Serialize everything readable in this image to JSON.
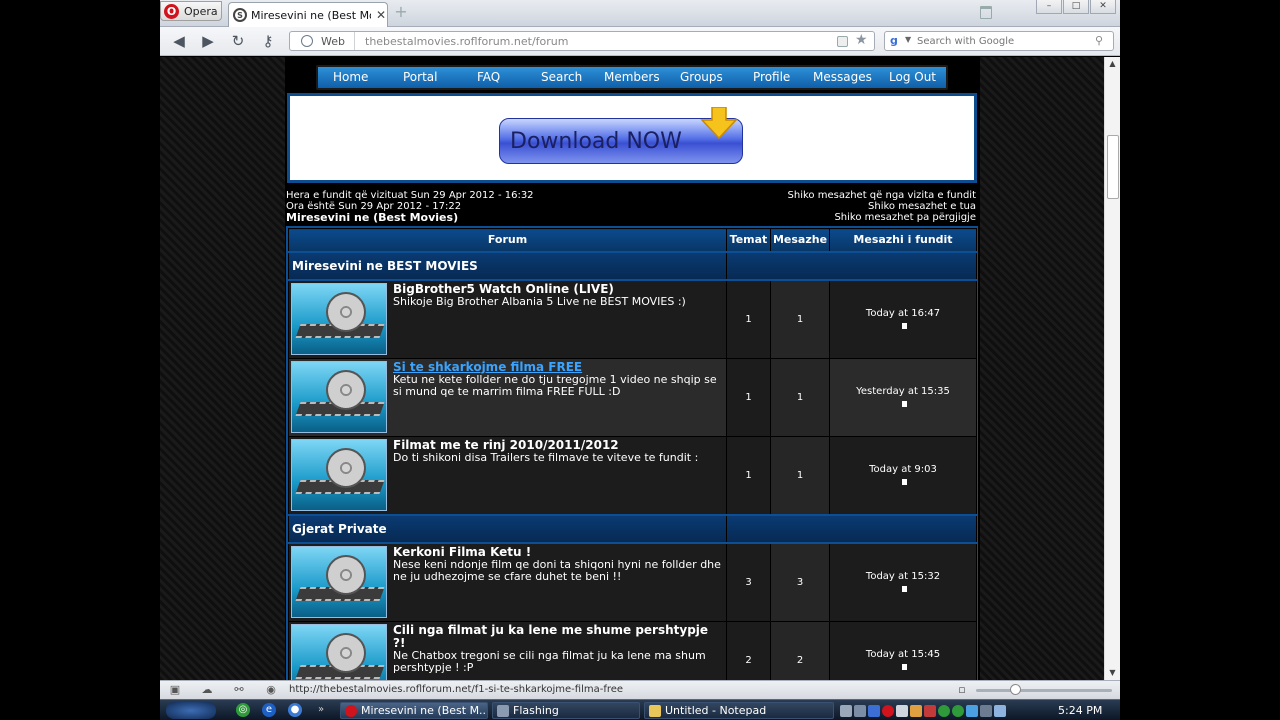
{
  "browser": {
    "menu_label": "Opera",
    "tab_title": "Miresevini ne (Best Mov...",
    "address_mode": "Web",
    "address_url": "thebestalmovies.roflforum.net/forum",
    "search_placeholder": "Search with Google",
    "status_url": "http://thebestalmovies.roflforum.net/f1-si-te-shkarkojme-filma-free"
  },
  "nav": {
    "items": [
      "Home",
      "Portal",
      "FAQ",
      "Search",
      "Members",
      "Groups",
      "Profile",
      "Messages",
      "Log Out"
    ]
  },
  "banner": {
    "button_label": "Download NOW"
  },
  "info": {
    "last_visit": "Hera e fundit që vizituat Sun 29 Apr 2012 - 16:32",
    "current_time": "Ora është Sun 29 Apr 2012 - 17:22",
    "board_title": "Miresevini ne (Best Movies)",
    "links": [
      "Shiko mesazhet që nga vizita e fundit",
      "Shiko mesazhet e tua",
      "Shiko mesazhet pa përgjigje"
    ]
  },
  "table": {
    "headers": [
      "Forum",
      "Temat",
      "Mesazhe",
      "Mesazhi i fundit"
    ],
    "categories": [
      {
        "title": "Miresevini ne BEST MOVIES",
        "forums": [
          {
            "title": "BigBrother5 Watch Online (LIVE)",
            "description": "Shikoje Big Brother Albania 5 Live ne BEST MOVIES :)",
            "topics": "1",
            "posts": "1",
            "last_post": "Today at 16:47"
          },
          {
            "title": "Si te shkarkojme filma FREE",
            "description": "Ketu ne kete follder ne do tju tregojme 1 video ne shqip se si mund qe te marrim filma FREE FULL :D",
            "topics": "1",
            "posts": "1",
            "last_post": "Yesterday at 15:35"
          },
          {
            "title": "Filmat me te rinj 2010/2011/2012",
            "description": "Do ti shikoni disa Trailers te filmave te viteve te fundit :",
            "topics": "1",
            "posts": "1",
            "last_post": "Today at 9:03"
          }
        ]
      },
      {
        "title": "Gjerat Private",
        "forums": [
          {
            "title": "Kerkoni Filma Ketu !",
            "description": "Nese keni ndonje film qe doni ta shiqoni hyni ne follder dhe ne ju udhezojme se cfare duhet te beni !!",
            "topics": "3",
            "posts": "3",
            "last_post": "Today at 15:32"
          },
          {
            "title": "Cili nga filmat ju ka lene me shume pershtypje ?!",
            "description": "Ne Chatbox tregoni se cili nga filmat ju ka lene ma shum pershtypje ! :P",
            "topics": "2",
            "posts": "2",
            "last_post": "Today at 15:45"
          }
        ]
      }
    ]
  },
  "taskbar": {
    "tasks": [
      "Miresevini ne (Best M...",
      "Flashing",
      "Untitled - Notepad"
    ],
    "clock": "5:24 PM"
  },
  "colors": {
    "accent": "#0d4f94",
    "menu": "#1f78c4",
    "link": "#3aa4ff"
  }
}
